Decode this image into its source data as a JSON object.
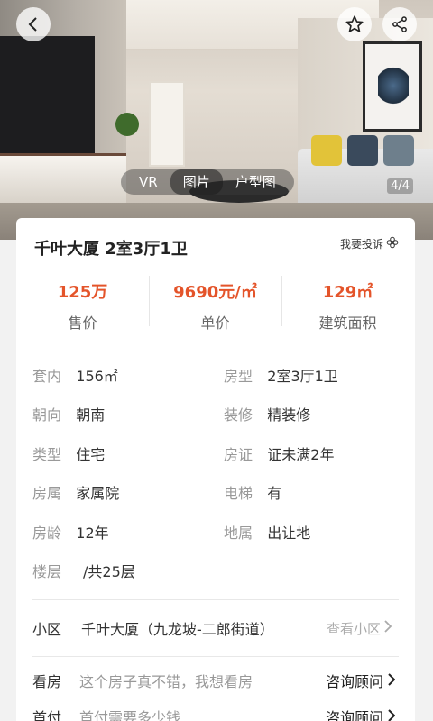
{
  "gallery": {
    "tabs": [
      "VR",
      "图片",
      "户型图"
    ],
    "active_tab": "图片",
    "counter": "4/4"
  },
  "header": {
    "back_icon": "chevron-left-icon",
    "favorite_icon": "star-icon",
    "share_icon": "share-icon"
  },
  "listing": {
    "title": "千叶大厦 2室3厅1卫",
    "report_label": "我要投诉"
  },
  "stats": [
    {
      "value": "125万",
      "label": "售价"
    },
    {
      "value": "9690元/㎡",
      "label": "单价"
    },
    {
      "value": "129㎡",
      "label": "建筑面积"
    }
  ],
  "attributes": [
    [
      {
        "label": "套内",
        "value": "156㎡"
      },
      {
        "label": "房型",
        "value": "2室3厅1卫"
      }
    ],
    [
      {
        "label": "朝向",
        "value": "朝南"
      },
      {
        "label": "装修",
        "value": "精装修"
      }
    ],
    [
      {
        "label": "类型",
        "value": "住宅"
      },
      {
        "label": "房证",
        "value": "证未满2年"
      }
    ],
    [
      {
        "label": "房属",
        "value": "家属院"
      },
      {
        "label": "电梯",
        "value": "有"
      }
    ],
    [
      {
        "label": "房龄",
        "value": "12年"
      },
      {
        "label": "地属",
        "value": "出让地"
      }
    ],
    [
      {
        "label": "楼层",
        "value": "/共25层"
      }
    ]
  ],
  "community": {
    "label": "小区",
    "value": "千叶大厦（九龙坡-二郎街道）",
    "more_label": "查看小区"
  },
  "actions": [
    {
      "label": "看房",
      "text": "这个房子真不错，我想看房",
      "button": "咨询顾问"
    },
    {
      "label": "首付",
      "text": "首付需要多少钱",
      "button": "咨询顾问"
    }
  ],
  "colors": {
    "accent": "#e4542a"
  }
}
